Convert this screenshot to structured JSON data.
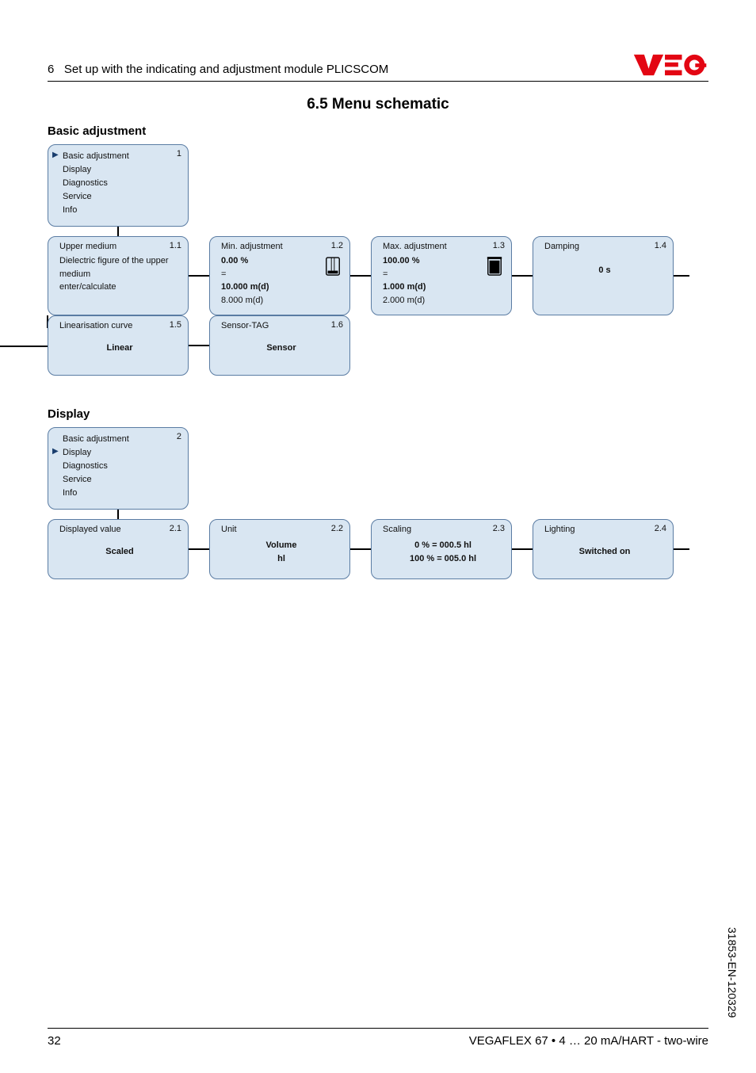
{
  "header": {
    "chapter_num": "6",
    "chapter_title": "Set up with the indicating and adjustment module PLICSCOM",
    "logo_text": "VEGA"
  },
  "page_title": "6.5   Menu schematic",
  "sections": {
    "basic": {
      "heading": "Basic adjustment",
      "menu": {
        "num": "1",
        "items": [
          "Basic adjustment",
          "Display",
          "Diagnostics",
          "Service",
          "Info"
        ],
        "pointer_index": 0
      },
      "row1": [
        {
          "num": "1.1",
          "title": "Upper medium",
          "lines": [
            "Dielectric figure of the upper",
            "medium",
            "enter/calculate"
          ]
        },
        {
          "num": "1.2",
          "title": "Min. adjustment",
          "lines_bold": [
            "0.00 %"
          ],
          "lines_plain_before": [
            "="
          ],
          "lines_bold2": [
            "10.000 m(d)"
          ],
          "lines_plain_after": [
            "8.000 m(d)"
          ],
          "icon": "tank-empty"
        },
        {
          "num": "1.3",
          "title": "Max. adjustment",
          "lines_bold": [
            "100.00 %"
          ],
          "lines_plain_before": [
            "="
          ],
          "lines_bold2": [
            "1.000 m(d)"
          ],
          "lines_plain_after": [
            "2.000 m(d)"
          ],
          "icon": "tank-full"
        },
        {
          "num": "1.4",
          "title": "Damping",
          "center_bold": "0 s"
        }
      ],
      "row2": [
        {
          "num": "1.5",
          "title": "Linearisation curve",
          "center_bold": "Linear"
        },
        {
          "num": "1.6",
          "title": "Sensor-TAG",
          "center_bold": "Sensor"
        }
      ]
    },
    "display": {
      "heading": "Display",
      "menu": {
        "num": "2",
        "items": [
          "Basic adjustment",
          "Display",
          "Diagnostics",
          "Service",
          "Info"
        ],
        "pointer_index": 1
      },
      "row1": [
        {
          "num": "2.1",
          "title": "Displayed value",
          "center_bold": "Scaled"
        },
        {
          "num": "2.2",
          "title": "Unit",
          "center_lines": [
            "Volume",
            "hl"
          ]
        },
        {
          "num": "2.3",
          "title": "Scaling",
          "center_lines": [
            "0 % = 000.5 hl",
            "100 % = 005.0 hl"
          ]
        },
        {
          "num": "2.4",
          "title": "Lighting",
          "center_bold": "Switched on"
        }
      ]
    }
  },
  "footer": {
    "page": "32",
    "product": "VEGAFLEX 67 • 4 … 20 mA/HART - two-wire",
    "side_code": "31853-EN-120329"
  }
}
